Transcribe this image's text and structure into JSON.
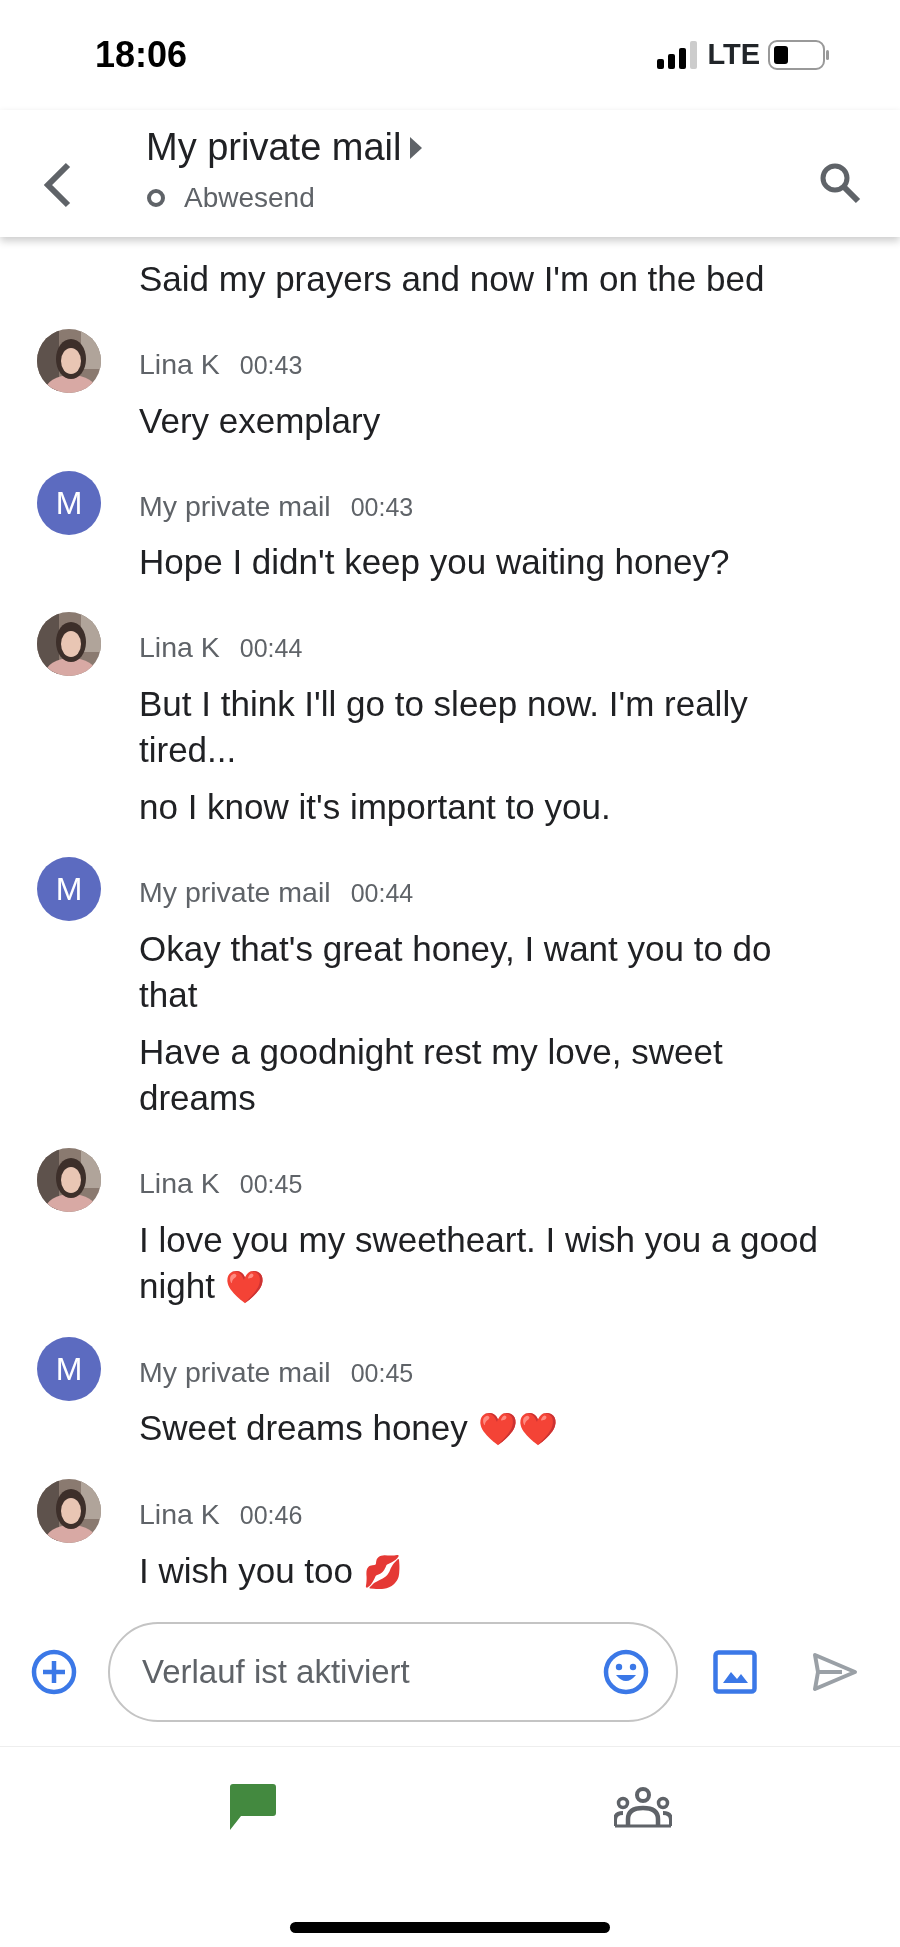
{
  "status_bar": {
    "time": "18:06",
    "network": "LTE"
  },
  "header": {
    "title": "My private mail",
    "status": "Abwesend"
  },
  "messages": [
    {
      "kind": "continuation",
      "lines": [
        {
          "text": "Said my prayers and now I'm on the bed"
        }
      ]
    },
    {
      "sender": "Lina K",
      "time": "00:43",
      "lines": [
        {
          "text": "Very exemplary"
        }
      ]
    },
    {
      "kind": "initial",
      "initial": "M",
      "sender": "My private mail",
      "time": "00:43",
      "lines": [
        {
          "text": "Hope I didn't keep you waiting honey?"
        }
      ]
    },
    {
      "sender": "Lina K",
      "time": "00:44",
      "lines": [
        {
          "text": "But I think I'll go to sleep now. I'm really tired..."
        },
        {
          "text": "no I know it's important to you."
        }
      ]
    },
    {
      "kind": "initial",
      "initial": "M",
      "sender": "My private mail",
      "time": "00:44",
      "lines": [
        {
          "text": "Okay that's great honey, I want you to do that"
        },
        {
          "text": "Have a goodnight rest my love, sweet dreams"
        }
      ]
    },
    {
      "sender": "Lina K",
      "time": "00:45",
      "lines": [
        {
          "text": "I love you my sweetheart. I wish you a good night",
          "emoji": "❤️"
        }
      ]
    },
    {
      "kind": "initial",
      "initial": "M",
      "sender": "My private mail",
      "time": "00:45",
      "lines": [
        {
          "text": "Sweet dreams honey",
          "emoji": "❤️❤️"
        }
      ]
    },
    {
      "sender": "Lina K",
      "time": "00:46",
      "lines": [
        {
          "text": "I wish you too",
          "emoji": "💋"
        }
      ]
    }
  ],
  "compose": {
    "placeholder": "Verlauf ist aktiviert"
  },
  "nav_tabs": [
    {
      "kind": "chat",
      "selected": true
    },
    {
      "kind": "people",
      "selected": false
    }
  ]
}
